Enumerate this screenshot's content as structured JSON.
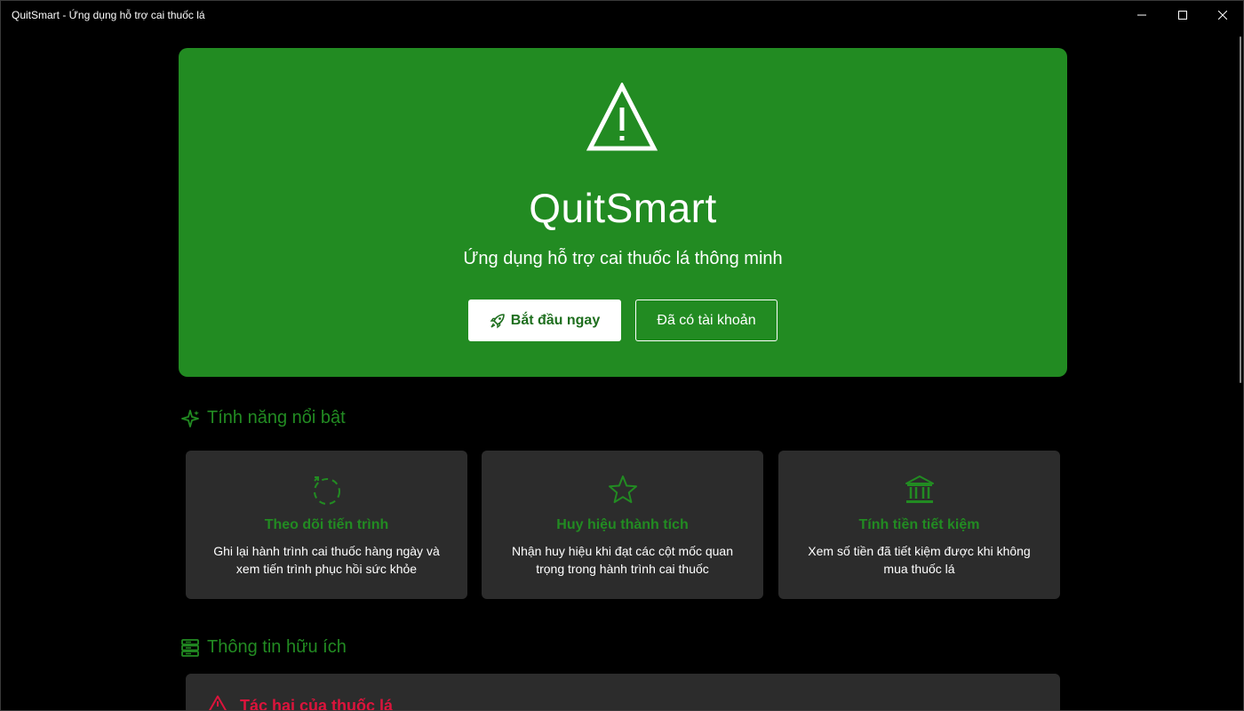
{
  "window": {
    "title": "QuitSmart - Ứng dụng hỗ trợ cai thuốc lá"
  },
  "hero": {
    "icon": "warning-triangle-icon",
    "title": "QuitSmart",
    "subtitle": "Ứng dụng hỗ trợ cai thuốc lá thông minh",
    "primary_button": "Bắt đầu ngay",
    "primary_button_icon": "rocket-icon",
    "secondary_button": "Đã có tài khoản"
  },
  "features": {
    "heading": "Tính năng nổi bật",
    "heading_icon": "sparkle-icon",
    "cards": [
      {
        "icon": "progress-arrows-icon",
        "title": "Theo dõi tiến trình",
        "description": "Ghi lại hành trình cai thuốc hàng ngày và xem tiến trình phục hồi sức khỏe"
      },
      {
        "icon": "star-icon",
        "title": "Huy hiệu thành tích",
        "description": "Nhận huy hiệu khi đạt các cột mốc quan trọng trong hành trình cai thuốc"
      },
      {
        "icon": "bank-icon",
        "title": "Tính tiền tiết kiệm",
        "description": "Xem số tiền đã tiết kiệm được khi không mua thuốc lá"
      }
    ]
  },
  "info": {
    "heading": "Thông tin hữu ích",
    "heading_icon": "library-icon",
    "cards": [
      {
        "icon": "warning-icon",
        "title": "Tác hại của thuốc lá"
      }
    ]
  },
  "colors": {
    "accent": "#228B22",
    "danger": "#DC143C",
    "card_bg": "#2C2C2C",
    "background": "#000000"
  }
}
